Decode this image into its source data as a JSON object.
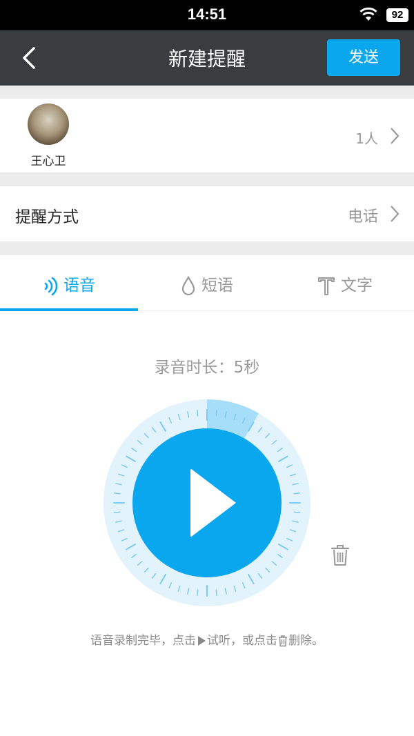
{
  "status_bar": {
    "time": "14:51",
    "battery": "92"
  },
  "nav": {
    "title": "新建提醒",
    "send_label": "发送"
  },
  "recipient": {
    "name": "王心卫",
    "count": "1人"
  },
  "method": {
    "label": "提醒方式",
    "value": "电话"
  },
  "tabs": [
    {
      "label": "语音",
      "icon": "voice-wave-icon",
      "active": true
    },
    {
      "label": "短语",
      "icon": "drop-icon",
      "active": false
    },
    {
      "label": "文字",
      "icon": "text-t-icon",
      "active": false
    }
  ],
  "recording": {
    "duration_text": "录音时长：5秒",
    "progress_fraction": 0.0833
  },
  "hint": {
    "part1": "语音录制完毕，点击",
    "part2": "试听，或点击",
    "part3": "删除。"
  },
  "colors": {
    "accent": "#0aa7ef",
    "nav_bg": "#3b3c40",
    "dial_ring": "#e3f3fc",
    "dial_progress": "#a6defa"
  }
}
